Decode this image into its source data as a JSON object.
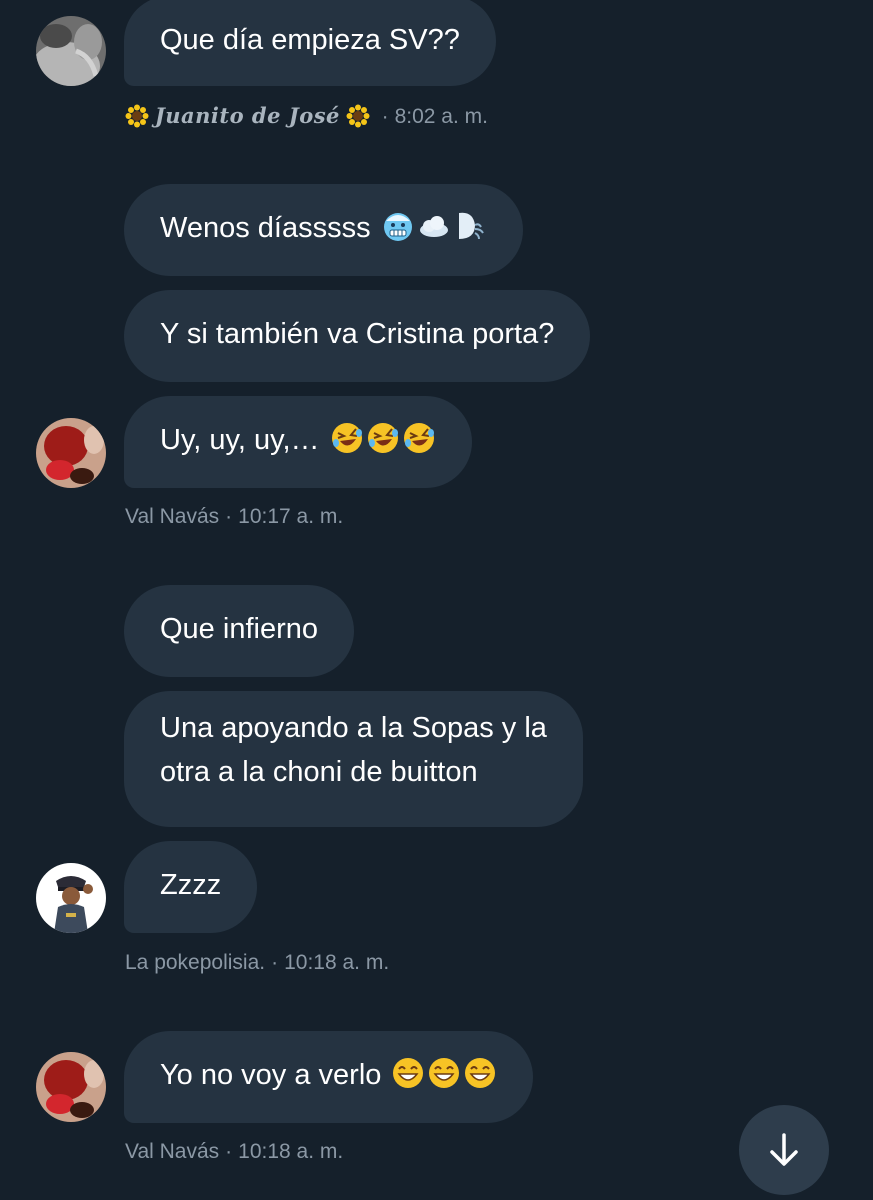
{
  "messages": [
    {
      "text": "Que día empieza SV??"
    },
    {
      "text": "Wenos díasssss",
      "emojis": [
        "cold-face-icon",
        "cloud-icon",
        "wind-face-icon"
      ]
    },
    {
      "text": "Y si también va Cristina porta?"
    },
    {
      "text": "Uy, uy, uy,…",
      "emojis": [
        "rolling-laughing-icon",
        "rolling-laughing-icon",
        "rolling-laughing-icon"
      ]
    },
    {
      "text": "Que infierno"
    },
    {
      "line1": "Una apoyando a la Sopas y la",
      "line2": "otra a la choni de buitton"
    },
    {
      "text": "Zzzz"
    },
    {
      "text": "Yo no voy a verlo",
      "emojis": [
        "grinning-face-icon",
        "grinning-face-icon",
        "grinning-face-icon"
      ]
    }
  ],
  "groups": [
    {
      "sender": "Juanito de José",
      "separator": "·",
      "time": "8:02 a. m."
    },
    {
      "sender": "Val Navás",
      "separator": "·",
      "time": "10:17 a. m."
    },
    {
      "sender": "La pokepolisia.",
      "separator": "·",
      "time": "10:18 a. m."
    },
    {
      "sender": "Val Navás",
      "separator": "·",
      "time": "10:18 a. m."
    }
  ],
  "icons": {
    "sender_decoration": "sunflower-icon",
    "scroll_button": "arrow-down-icon"
  },
  "colors": {
    "background": "#15202b",
    "bubble": "#253341",
    "meta_text": "#8b98a5"
  }
}
